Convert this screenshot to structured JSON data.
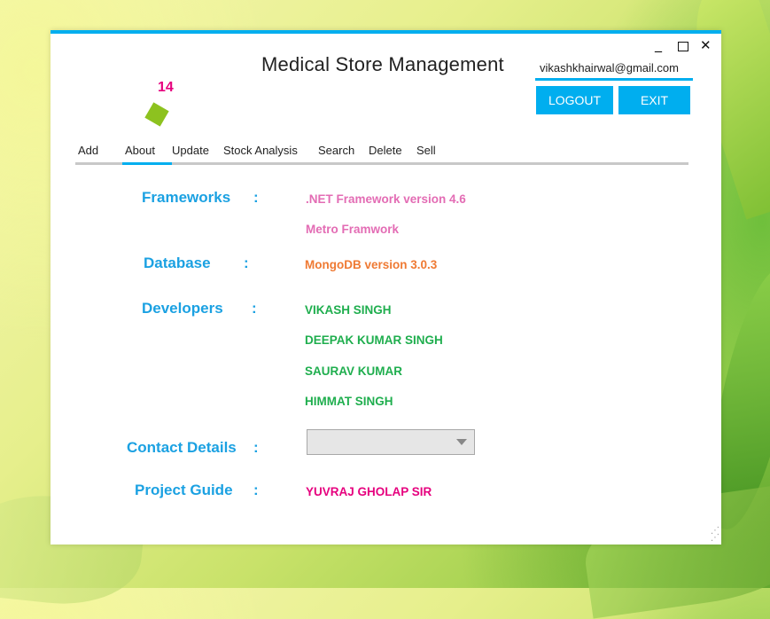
{
  "window": {
    "title": "Medical Store Management",
    "controls": {
      "minimize": "_",
      "maximize": "",
      "close": "✕"
    }
  },
  "user": {
    "email": "vikashkhairwal@gmail.com"
  },
  "buttons": {
    "logout": "LOGOUT",
    "exit": "EXIT"
  },
  "badge": {
    "count": "14",
    "icon": "tile-icon"
  },
  "tabs": [
    {
      "label": "Add"
    },
    {
      "label": "About",
      "active": true
    },
    {
      "label": "Update"
    },
    {
      "label": "Stock Analysis"
    },
    {
      "label": "Search"
    },
    {
      "label": "Delete"
    },
    {
      "label": "Sell"
    }
  ],
  "about": {
    "colon": ":",
    "frameworks": {
      "label": "Frameworks",
      "values": [
        ".NET Framework version 4.6",
        "Metro Framwork"
      ]
    },
    "database": {
      "label": "Database",
      "value": "MongoDB version 3.0.3"
    },
    "developers": {
      "label": "Developers",
      "values": [
        "VIKASH SINGH",
        "DEEPAK KUMAR SINGH",
        "SAURAV KUMAR",
        "HIMMAT SINGH"
      ]
    },
    "contact": {
      "label": "Contact Details",
      "selected": ""
    },
    "guide": {
      "label": "Project Guide",
      "value": "YUVRAJ GHOLAP SIR"
    }
  },
  "colors": {
    "accent": "#00aeef",
    "label": "#1ba1e2",
    "framework": "#e36cb4",
    "database": "#ef7a33",
    "developer": "#1fae4e",
    "guide": "#e6007e",
    "badge_icon": "#8dc21f"
  }
}
